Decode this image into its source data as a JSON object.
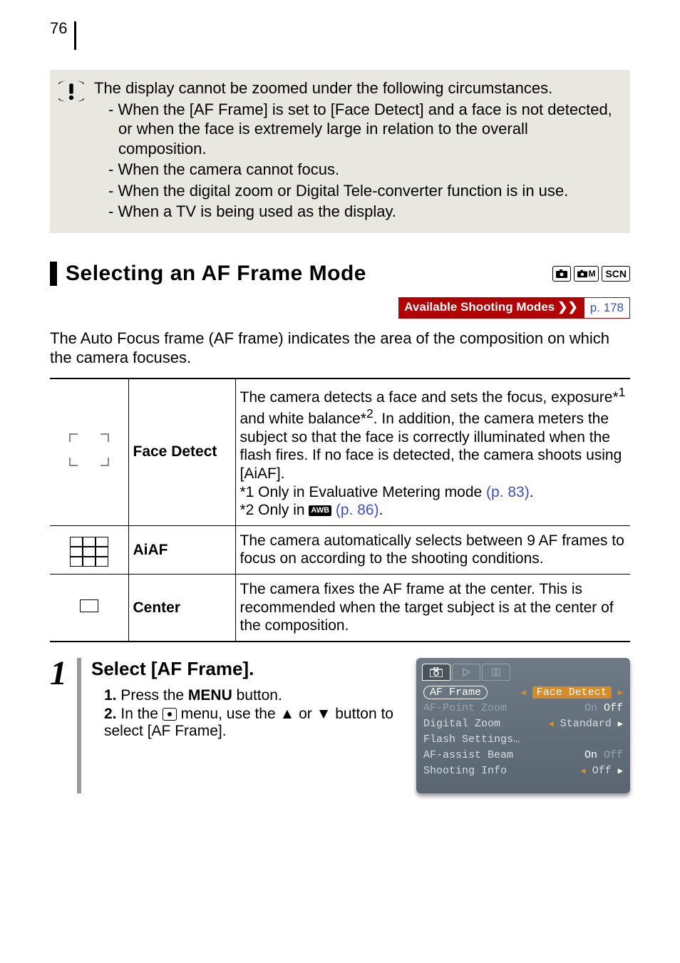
{
  "page_number": "76",
  "warning": {
    "lead": "The display cannot be zoomed under the following circumstances.",
    "items": [
      "When the [AF Frame] is set to [Face Detect] and a face is not detected, or when the face is extremely large in relation to the overall composition.",
      "When the camera cannot focus.",
      "When the digital zoom or Digital Tele-converter function is in use.",
      "When a TV is being used as the display."
    ]
  },
  "section": {
    "title": "Selecting an AF Frame Mode",
    "mode_icons": [
      "●",
      "●M",
      "SCN"
    ],
    "avail_label": "Available Shooting Modes",
    "avail_link": "p. 178",
    "intro": "The Auto Focus frame (AF frame) indicates the area of the composition on which the camera focuses."
  },
  "table": [
    {
      "label": "Face Detect",
      "desc_pre": "The camera detects a face and sets the focus, exposure*",
      "sup1": "1",
      "desc_mid": " and white balance*",
      "sup2": "2",
      "desc_post": ". In addition, the camera meters the subject so that the face is correctly illuminated when the flash fires. If no face is detected, the camera shoots using [AiAF].",
      "note1_pre": "*1 Only in Evaluative Metering mode ",
      "note1_link": "(p. 83)",
      "note2_pre": "*2 Only in ",
      "note2_icon": "AWB",
      "note2_link": "(p. 86)"
    },
    {
      "label": "AiAF",
      "desc": "The camera automatically selects between 9 AF frames to focus on according to the shooting conditions."
    },
    {
      "label": "Center",
      "desc": "The camera fixes the AF frame at the center. This is recommended when the target subject is at the center of the composition."
    }
  ],
  "step": {
    "num": "1",
    "title": "Select [AF Frame].",
    "substeps": [
      {
        "n": "1.",
        "pre": "Press the ",
        "bold": "MENU",
        "post": " button."
      },
      {
        "n": "2.",
        "pre": "In the ",
        "icon": true,
        "mid": " menu, use the ▲ or ▼ button to select [AF Frame].",
        "post": ""
      }
    ]
  },
  "lcd": {
    "rows": [
      {
        "key": "AF Frame",
        "val": "Face Detect",
        "selected": true
      },
      {
        "key": "AF-Point Zoom",
        "val_on": "On",
        "val_off": "Off",
        "active": "Off"
      },
      {
        "key": "Digital Zoom",
        "val": "Standard",
        "caret": true
      },
      {
        "key": "Flash Settings…",
        "val": ""
      },
      {
        "key": "AF-assist Beam",
        "val_on": "On",
        "val_off": "Off",
        "active": "On"
      },
      {
        "key": "Shooting Info",
        "val": "Off",
        "caret": true
      }
    ]
  }
}
